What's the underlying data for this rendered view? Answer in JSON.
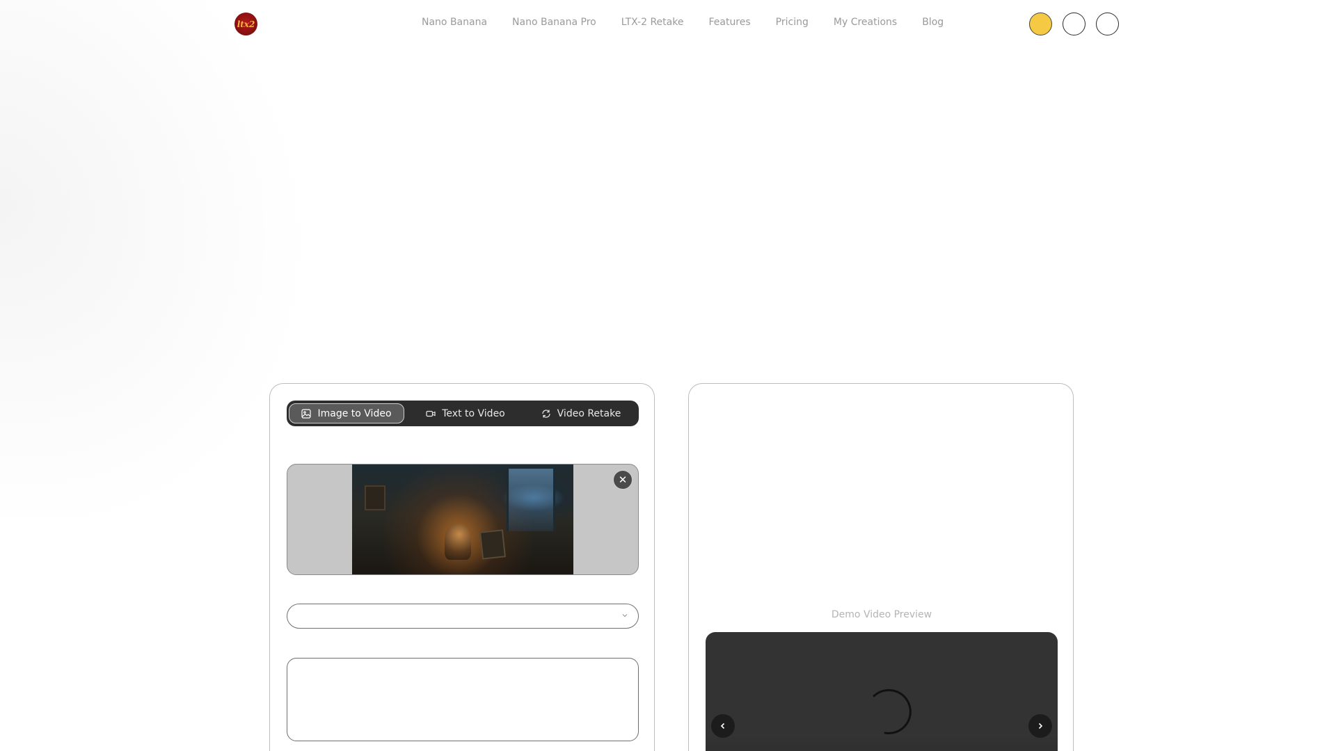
{
  "header": {
    "logo_text": "ltx2",
    "nav": [
      {
        "label": "Nano Banana"
      },
      {
        "label": "Nano Banana Pro"
      },
      {
        "label": "LTX-2 Retake"
      },
      {
        "label": "Features"
      },
      {
        "label": "Pricing"
      },
      {
        "label": "My Creations"
      },
      {
        "label": "Blog"
      }
    ],
    "circle_colors": [
      "#f6c945",
      "#ffffff",
      "#ffffff"
    ]
  },
  "generator": {
    "tabs": [
      {
        "label": "Image to Video",
        "icon": "image-icon",
        "active": true
      },
      {
        "label": "Text to Video",
        "icon": "video-camera-icon",
        "active": false
      },
      {
        "label": "Video Retake",
        "icon": "refresh-icon",
        "active": false
      }
    ],
    "upload": {
      "close_symbol": "✕"
    },
    "select_value": "",
    "prompt_value": ""
  },
  "preview": {
    "label": "Demo Video Preview"
  }
}
